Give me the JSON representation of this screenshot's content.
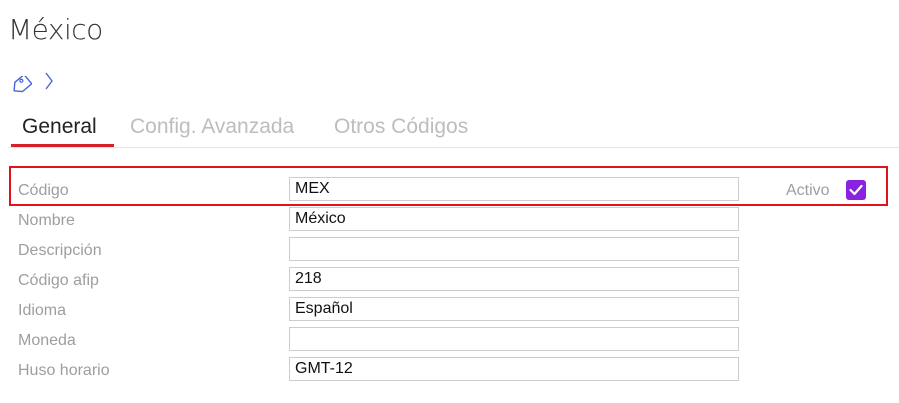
{
  "page": {
    "title": "México"
  },
  "breadcrumb": {
    "icons": [
      "tag-icon",
      "chevron-right-icon"
    ]
  },
  "tabs": [
    {
      "label": "General",
      "active": true
    },
    {
      "label": "Config. Avanzada",
      "active": false
    },
    {
      "label": "Otros Códigos",
      "active": false
    }
  ],
  "form": {
    "codigo": {
      "label": "Código",
      "value": "MEX"
    },
    "nombre": {
      "label": "Nombre",
      "value": "México"
    },
    "descripcion": {
      "label": "Descripción",
      "value": ""
    },
    "codigo_afip": {
      "label": "Código afip",
      "value": "218"
    },
    "idioma": {
      "label": "Idioma",
      "value": "Español"
    },
    "moneda": {
      "label": "Moneda",
      "value": ""
    },
    "huso_horario": {
      "label": "Huso horario",
      "value": "GMT-12"
    },
    "activo": {
      "label": "Activo",
      "checked": true
    }
  },
  "colors": {
    "accent_underline": "#d6202a",
    "highlight_border": "#e0121c",
    "checkbox": "#8a22e0",
    "icon": "#4a64d8"
  }
}
